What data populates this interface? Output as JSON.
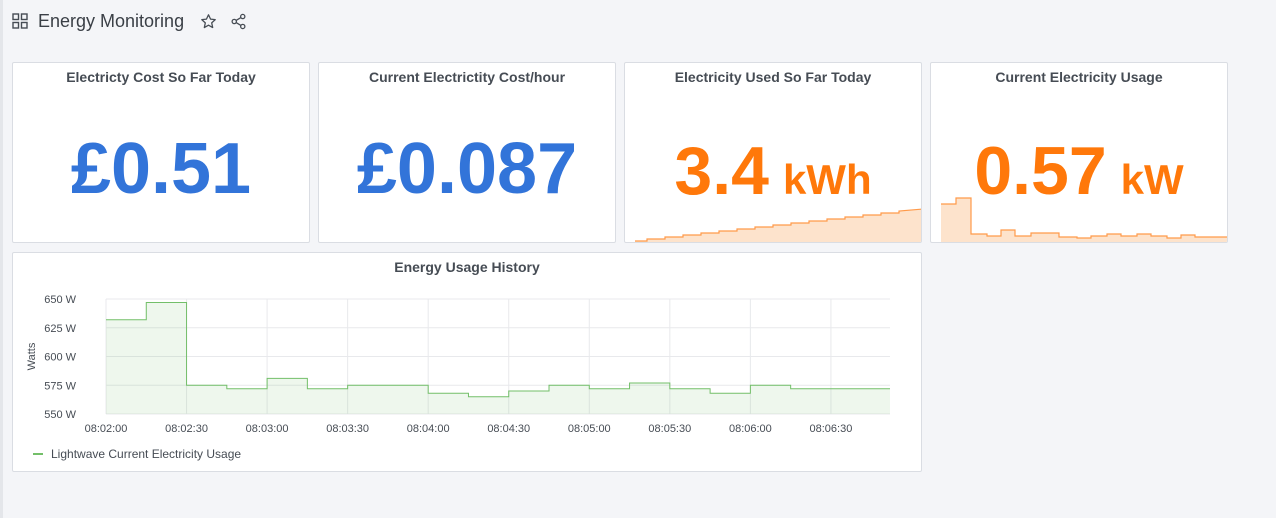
{
  "dashboard": {
    "title": "Energy Monitoring",
    "icons": {
      "grid": "grid-icon",
      "star": "star-icon",
      "share": "share-icon"
    }
  },
  "colors": {
    "blue": "#3274d9",
    "orange": "#ff780a",
    "green": "#73bf69",
    "orange_fill": "#fde3cc"
  },
  "panels": {
    "cost_today": {
      "title": "Electricty Cost So Far Today",
      "value": "£0.51"
    },
    "cost_hour": {
      "title": "Current Electrictity Cost/hour",
      "value": "£0.087"
    },
    "used_today": {
      "title": "Electricity Used So Far Today",
      "value": "3.4",
      "unit": "kWh"
    },
    "current_usage": {
      "title": "Current Electricity Usage",
      "value": "0.57",
      "unit": "kW"
    }
  },
  "history": {
    "title": "Energy Usage History",
    "legend": "Lightwave Current Electricity Usage"
  },
  "chart_data": {
    "type": "area",
    "title": "Energy Usage History",
    "ylabel": "Watts",
    "xlabel": "",
    "ylim": [
      550,
      650
    ],
    "yticks": [
      "550 W",
      "575 W",
      "600 W",
      "625 W",
      "650 W"
    ],
    "xticks": [
      "08:02:00",
      "08:02:30",
      "08:03:00",
      "08:03:30",
      "08:04:00",
      "08:04:30",
      "08:05:00",
      "08:05:30",
      "08:06:00",
      "08:06:30"
    ],
    "grid": true,
    "legend_position": "bottom-left",
    "series": [
      {
        "name": "Lightwave Current Electricity Usage",
        "color": "#73bf69",
        "step": true,
        "x_seconds_from_0802": [
          0,
          15,
          30,
          45,
          60,
          75,
          90,
          105,
          120,
          135,
          150,
          165,
          180,
          195,
          210,
          225,
          240,
          255,
          270,
          285,
          292
        ],
        "values": [
          632,
          647,
          575,
          572,
          581,
          572,
          575,
          575,
          568,
          565,
          570,
          575,
          572,
          577,
          572,
          568,
          575,
          572,
          572,
          572,
          572
        ]
      }
    ]
  }
}
